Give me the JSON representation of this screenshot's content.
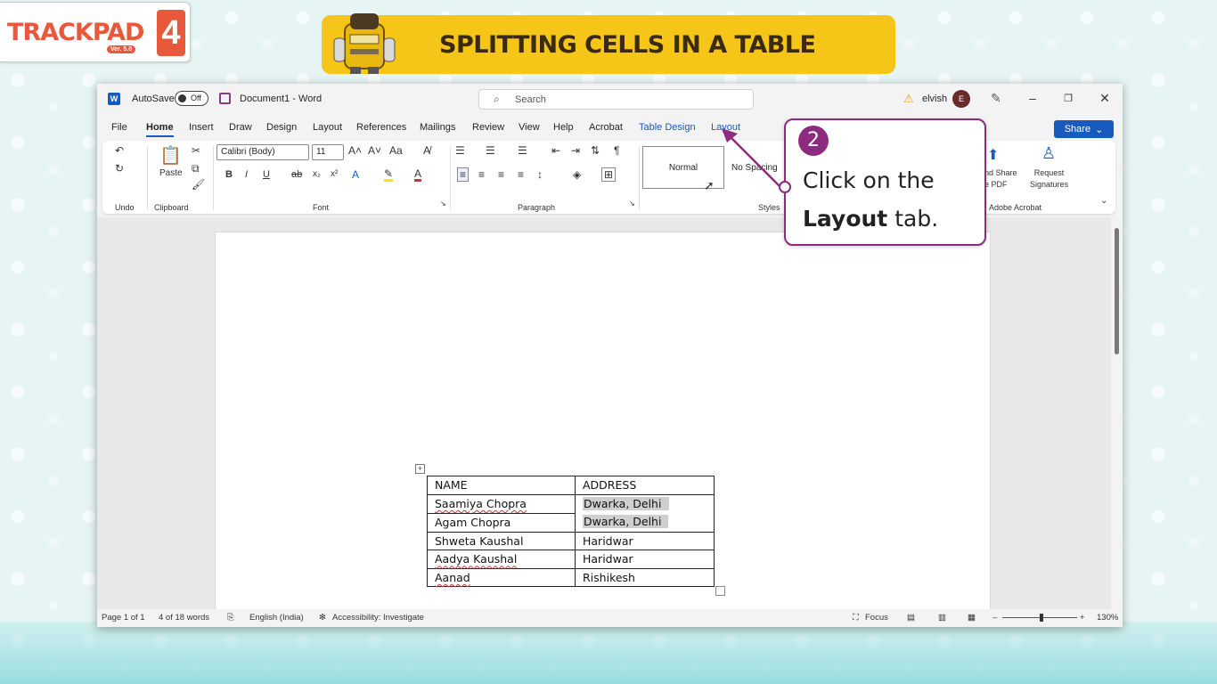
{
  "branding": {
    "logo_text": "TRACKPAD",
    "logo_version": "Ver. 5.0",
    "logo_number": "4",
    "banner_title": "SPLITTING CELLS IN A TABLE"
  },
  "titlebar": {
    "autosave_label": "AutoSave",
    "autosave_state": "Off",
    "document_title": "Document1  -  Word",
    "search_placeholder": "Search",
    "user_name": "elvish",
    "user_initial": "E"
  },
  "tabs": [
    {
      "label": "File"
    },
    {
      "label": "Home"
    },
    {
      "label": "Insert"
    },
    {
      "label": "Draw"
    },
    {
      "label": "Design"
    },
    {
      "label": "Layout"
    },
    {
      "label": "References"
    },
    {
      "label": "Mailings"
    },
    {
      "label": "Review"
    },
    {
      "label": "View"
    },
    {
      "label": "Help"
    },
    {
      "label": "Acrobat"
    },
    {
      "label": "Table Design"
    },
    {
      "label": "Layout"
    }
  ],
  "share_label": "Share",
  "ribbon": {
    "groups": {
      "undo": "Undo",
      "clipboard": "Clipboard",
      "font": "Font",
      "paragraph": "Paragraph",
      "styles": "Styles",
      "adobe": "Adobe Acrobat"
    },
    "paste_label": "Paste",
    "font_name": "Calibri (Body)",
    "font_size": "11",
    "style_normal": "Normal",
    "style_nospacing": "No Spacing",
    "adobe_share_pdf": "nd Share\ne PDF",
    "adobe_request_sig": "Request\nSignatures"
  },
  "table": {
    "header": [
      "NAME",
      "ADDRESS"
    ],
    "rows": [
      [
        "Saamiya Chopra",
        "Dwarka, Delhi"
      ],
      [
        "Agam Chopra",
        "Dwarka, Delhi"
      ],
      [
        "Shweta Kaushal",
        "Haridwar"
      ],
      [
        "Aadya Kaushal",
        "Haridwar"
      ],
      [
        "Aanad",
        "Rishikesh"
      ]
    ]
  },
  "statusbar": {
    "page": "Page 1 of 1",
    "words": "4 of 18 words",
    "language": "English (India)",
    "accessibility": "Accessibility: Investigate",
    "focus": "Focus",
    "zoom": "130%"
  },
  "callout": {
    "step": "2",
    "line1": "Click on the",
    "bold": "Layout",
    "line2_rest": " tab."
  },
  "colors": {
    "accent_word": "#185abd",
    "callout_border": "#8e2a7f",
    "banner": "#f5c518",
    "brand_orange": "#e8583b"
  }
}
